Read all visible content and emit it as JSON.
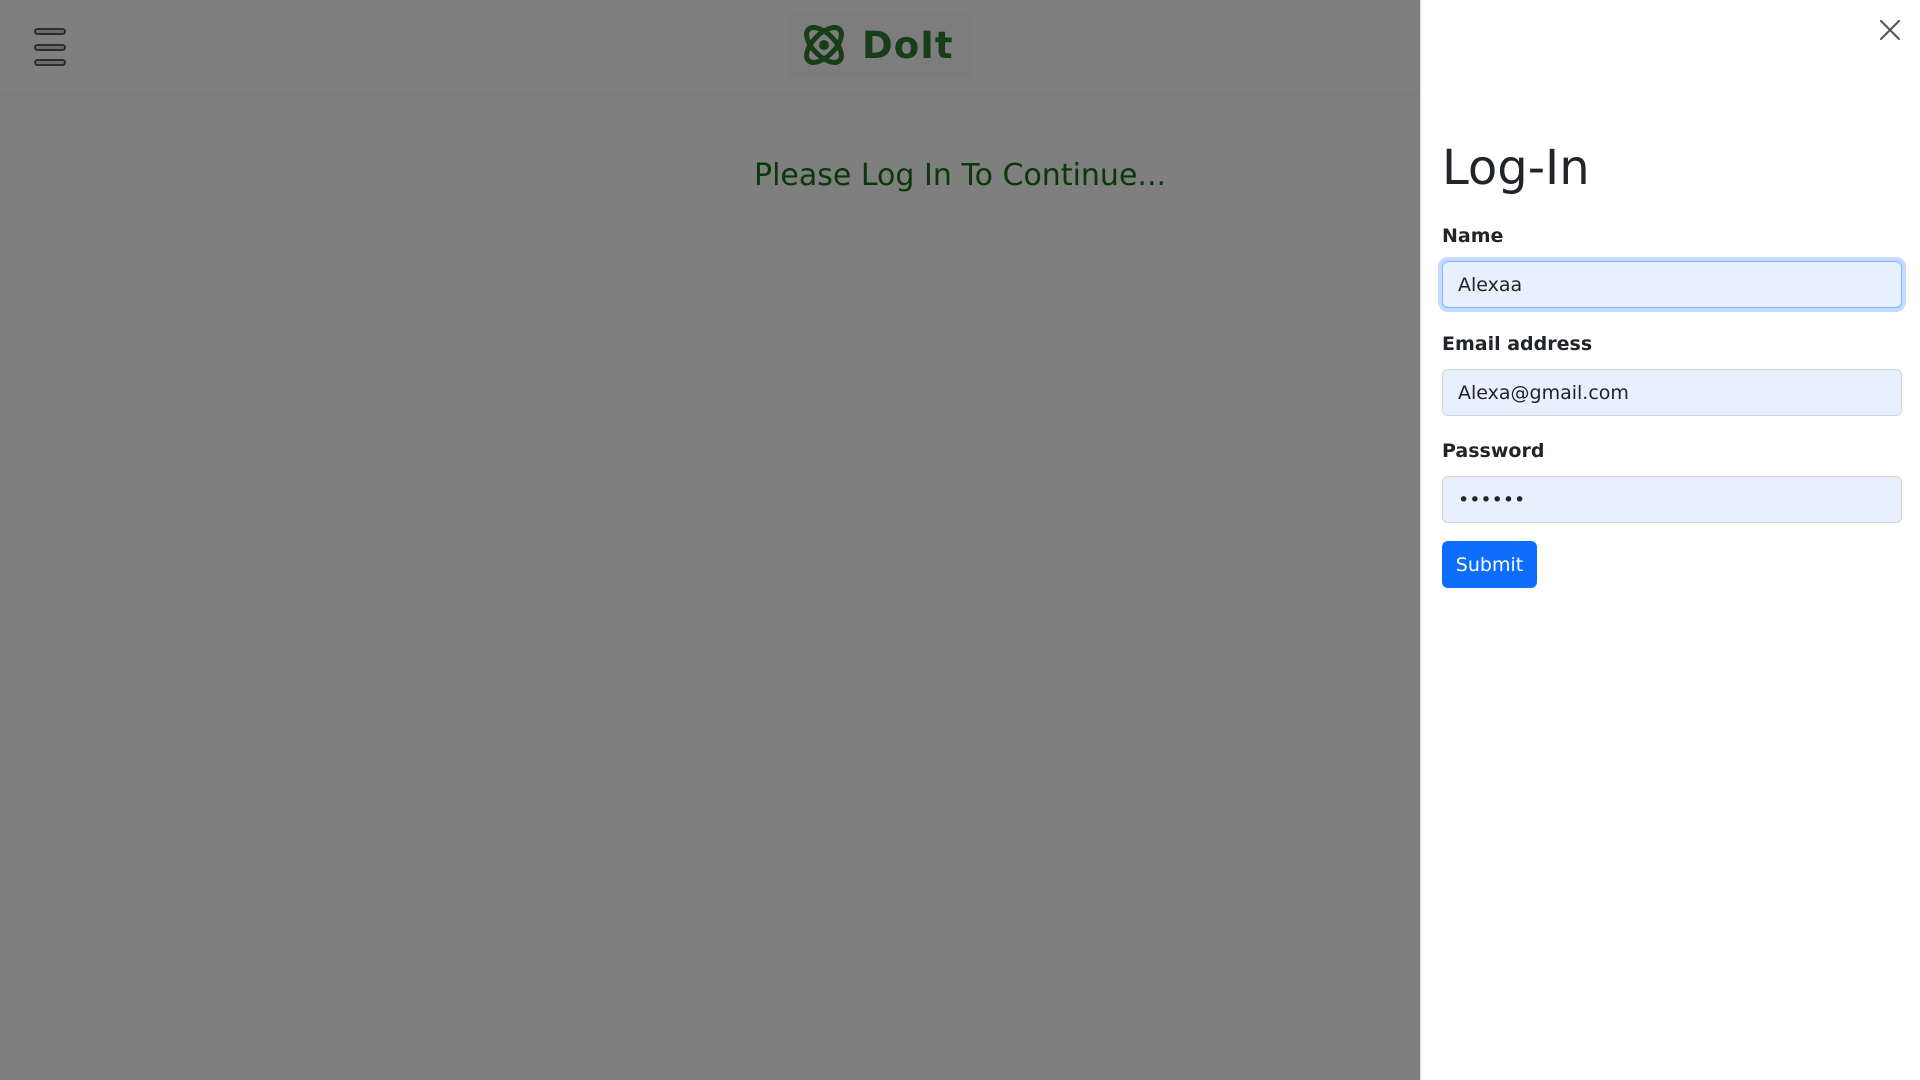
{
  "navbar": {
    "menu_icon": "hamburger-menu-icon",
    "brand_name": "DoIt",
    "brand_icon": "atom-logo-icon",
    "brand_color": "#2e7d32"
  },
  "main": {
    "message": "Please Log In To Continue...",
    "message_color": "#137313"
  },
  "login_panel": {
    "title": "Log-In",
    "close_icon": "close-icon",
    "name_label": "Name",
    "name_value": "Alexaa",
    "email_label": "Email address",
    "email_value": "Alexa@gmail.com",
    "password_label": "Password",
    "password_value": "••••••",
    "submit_label": "Submit",
    "accent_color": "#0d6efd"
  }
}
